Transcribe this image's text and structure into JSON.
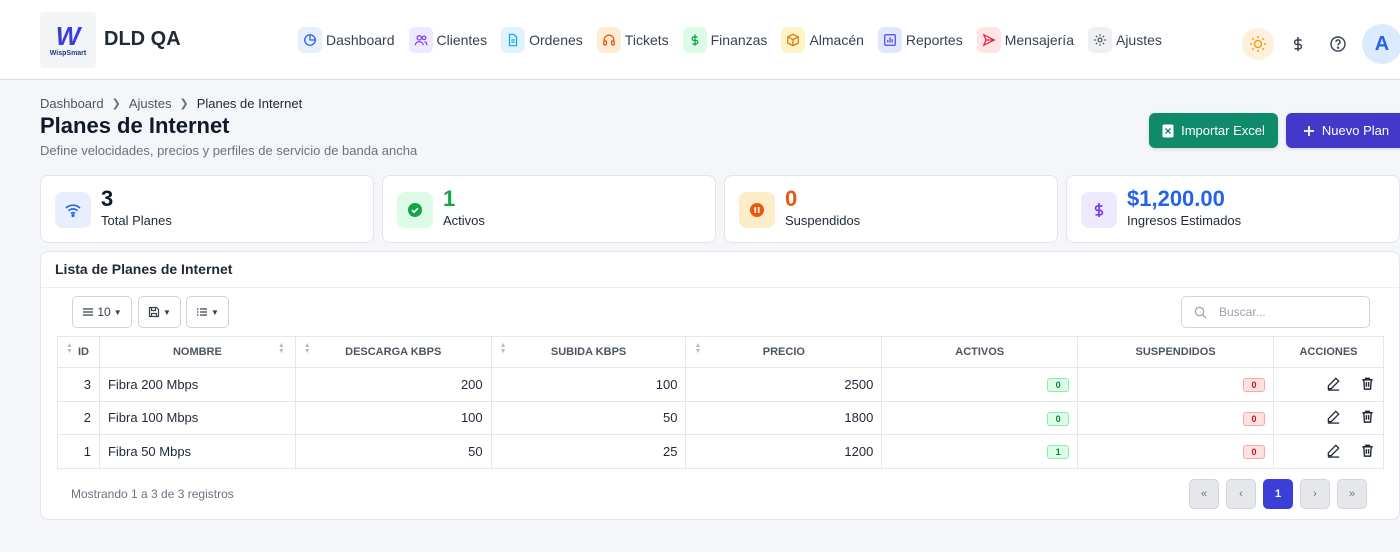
{
  "brand": {
    "logo_text": "WispSmart",
    "title": "DLD QA"
  },
  "nav": [
    {
      "label": "Dashboard",
      "icon": "pie-chart-icon",
      "bg": "#e8eefc",
      "fg": "#2563eb"
    },
    {
      "label": "Clientes",
      "icon": "users-icon",
      "bg": "#ede9fe",
      "fg": "#7c3aed"
    },
    {
      "label": "Ordenes",
      "icon": "document-icon",
      "bg": "#e0f2fe",
      "fg": "#0ea5e9"
    },
    {
      "label": "Tickets",
      "icon": "headset-icon",
      "bg": "#ffedd5",
      "fg": "#ea580c"
    },
    {
      "label": "Finanzas",
      "icon": "dollar-icon",
      "bg": "#dcfce7",
      "fg": "#16a34a"
    },
    {
      "label": "Almacén",
      "icon": "box-icon",
      "bg": "#fef3c7",
      "fg": "#d97706"
    },
    {
      "label": "Reportes",
      "icon": "bar-chart-icon",
      "bg": "#e0e7ff",
      "fg": "#4f46e5"
    },
    {
      "label": "Mensajería",
      "icon": "send-icon",
      "bg": "#ffe4e6",
      "fg": "#e11d48"
    },
    {
      "label": "Ajustes",
      "icon": "gear-icon",
      "bg": "#eef0f3",
      "fg": "#4b5563"
    }
  ],
  "user": {
    "avatar_letter": "A"
  },
  "breadcrumb": {
    "b1": "Dashboard",
    "b2": "Ajustes",
    "b3": "Planes de Internet"
  },
  "page": {
    "title": "Planes de Internet",
    "subtitle": "Define velocidades, precios y perfiles de servicio de banda ancha",
    "import_label": "Importar Excel",
    "new_label": "Nuevo Plan"
  },
  "stats": [
    {
      "value": "3",
      "label": "Total Planes",
      "icon": "wifi-icon",
      "color": "#111827",
      "icon_bg": "#e8eefc",
      "icon_fg": "#2563eb"
    },
    {
      "value": "1",
      "label": "Activos",
      "icon": "check-circle-icon",
      "color": "#16a34a",
      "icon_bg": "#dcfce7",
      "icon_fg": "#16a34a"
    },
    {
      "value": "0",
      "label": "Suspendidos",
      "icon": "pause-circle-icon",
      "color": "#ea580c",
      "icon_bg": "#fdecc8",
      "icon_fg": "#ea580c"
    },
    {
      "value": "$1,200.00",
      "label": "Ingresos Estimados",
      "icon": "dollar-icon",
      "color": "#2563eb",
      "icon_bg": "#ede9fe",
      "icon_fg": "#7c3aed"
    }
  ],
  "table": {
    "title": "Lista de Planes de Internet",
    "page_length": "10",
    "search_placeholder": "Buscar...",
    "columns": [
      "ID",
      "Nombre",
      "Descarga Kbps",
      "Subida Kbps",
      "Precio",
      "Activos",
      "Suspendidos",
      "Acciones"
    ],
    "rows": [
      {
        "id": "3",
        "nombre": "Fibra 200 Mbps",
        "descarga": "200",
        "subida": "100",
        "precio": "2500",
        "activos": "0",
        "suspendidos": "0"
      },
      {
        "id": "2",
        "nombre": "Fibra 100 Mbps",
        "descarga": "100",
        "subida": "50",
        "precio": "1800",
        "activos": "0",
        "suspendidos": "0"
      },
      {
        "id": "1",
        "nombre": "Fibra 50 Mbps",
        "descarga": "50",
        "subida": "25",
        "precio": "1200",
        "activos": "1",
        "suspendidos": "0"
      }
    ],
    "info": "Mostrando 1 a 3 de 3 registros",
    "pager": {
      "first": "«",
      "prev": "‹",
      "current": "1",
      "next": "›",
      "last": "»"
    }
  }
}
